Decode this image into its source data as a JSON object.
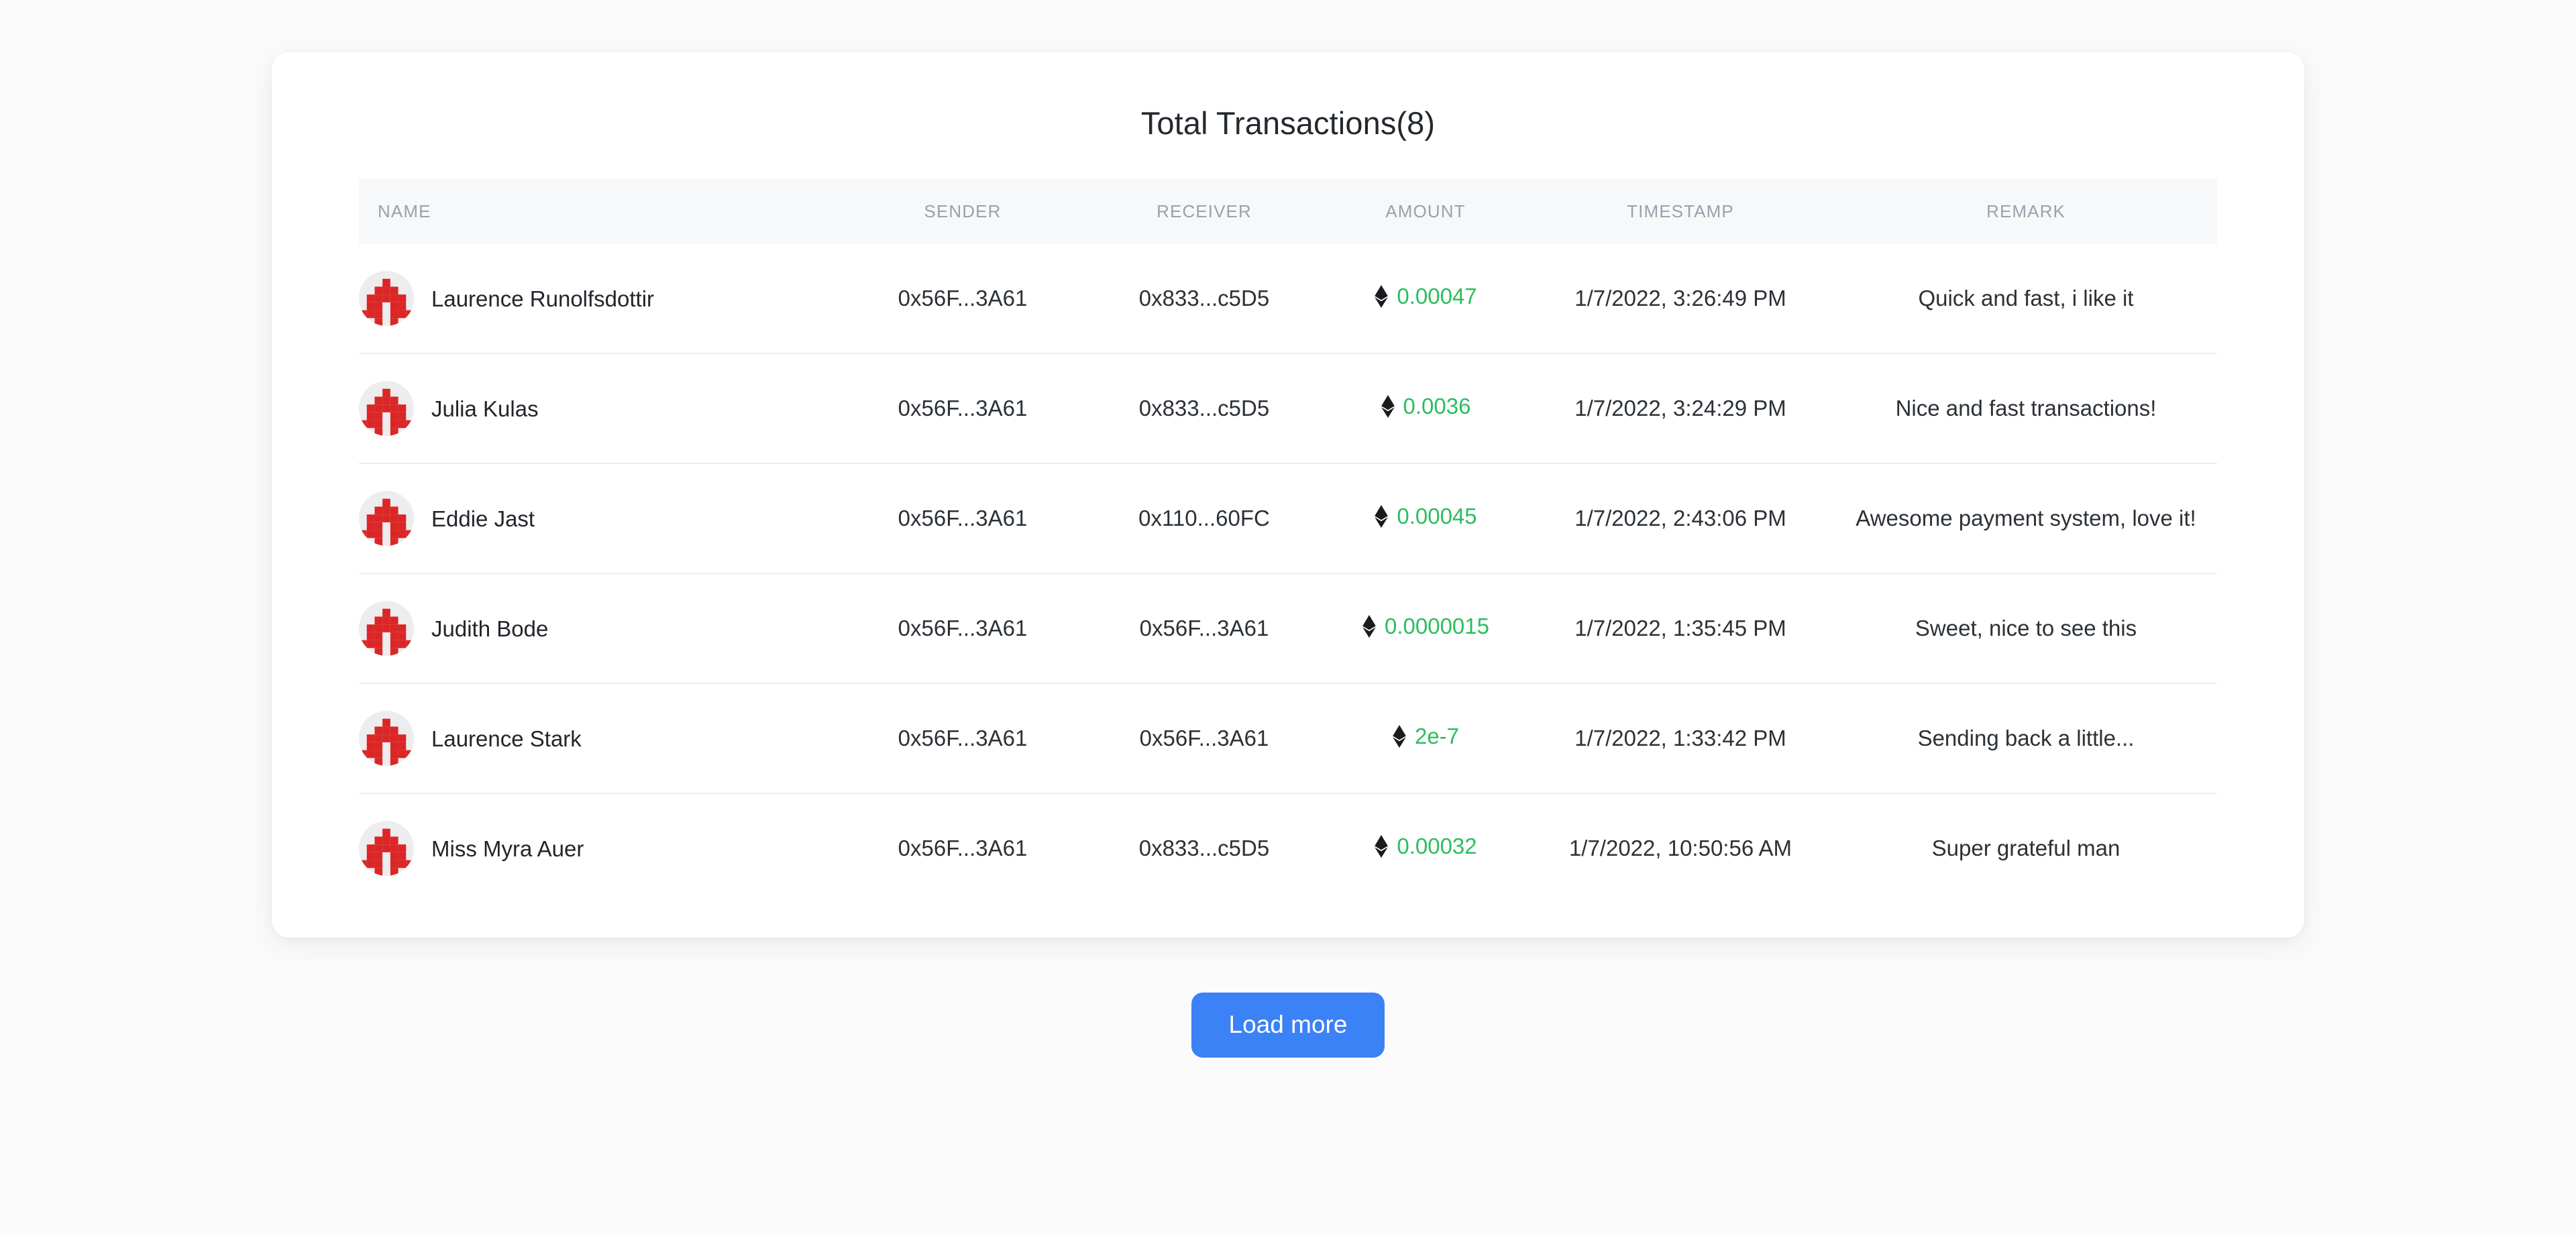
{
  "page": {
    "background_color": "#fbfbfc",
    "card_background": "#ffffff"
  },
  "card": {
    "title": "Total Transactions(8)"
  },
  "table": {
    "headers": {
      "name": "NAME",
      "sender": "SENDER",
      "receiver": "RECEIVER",
      "amount": "AMOUNT",
      "timestamp": "TIMESTAMP",
      "remark": "REMARK"
    },
    "header_background": "#f7f8fa",
    "header_text_color": "#9aa1ad",
    "amount_color": "#2cbd5e",
    "currency_icon": "ethereum-icon",
    "avatar_icon": "identicon-avatar",
    "avatar_accent_color": "#dc2626",
    "rows": [
      {
        "name": "Laurence Runolfsdottir",
        "sender": "0x56F...3A61",
        "receiver": "0x833...c5D5",
        "amount": "0.00047",
        "timestamp": "1/7/2022, 3:26:49 PM",
        "remark": "Quick and fast, i like it"
      },
      {
        "name": "Julia Kulas",
        "sender": "0x56F...3A61",
        "receiver": "0x833...c5D5",
        "amount": "0.0036",
        "timestamp": "1/7/2022, 3:24:29 PM",
        "remark": "Nice and fast transactions!"
      },
      {
        "name": "Eddie Jast",
        "sender": "0x56F...3A61",
        "receiver": "0x110...60FC",
        "amount": "0.00045",
        "timestamp": "1/7/2022, 2:43:06 PM",
        "remark": "Awesome payment system, love it!"
      },
      {
        "name": "Judith Bode",
        "sender": "0x56F...3A61",
        "receiver": "0x56F...3A61",
        "amount": "0.0000015",
        "timestamp": "1/7/2022, 1:35:45 PM",
        "remark": "Sweet, nice to see this"
      },
      {
        "name": "Laurence Stark",
        "sender": "0x56F...3A61",
        "receiver": "0x56F...3A61",
        "amount": "2e-7",
        "timestamp": "1/7/2022, 1:33:42 PM",
        "remark": "Sending back a little..."
      },
      {
        "name": "Miss Myra Auer",
        "sender": "0x56F...3A61",
        "receiver": "0x833...c5D5",
        "amount": "0.00032",
        "timestamp": "1/7/2022, 10:50:56 AM",
        "remark": "Super grateful man"
      }
    ]
  },
  "footer": {
    "load_more_label": "Load more",
    "load_more_color": "#3b82f6"
  }
}
